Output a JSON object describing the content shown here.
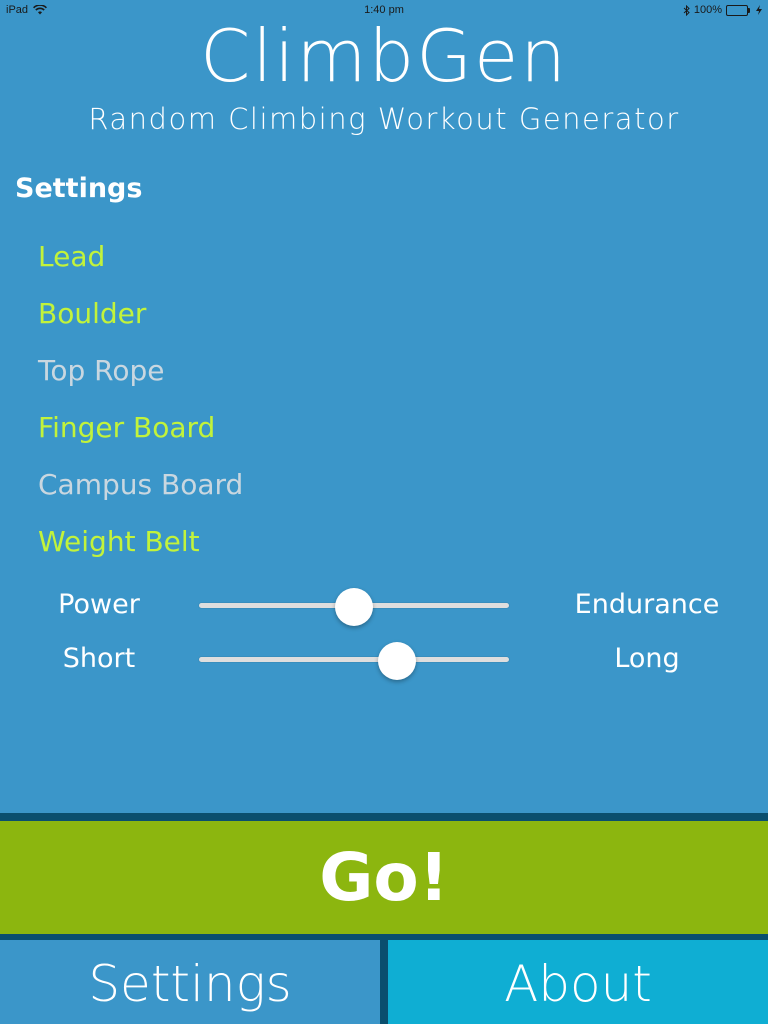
{
  "status_bar": {
    "device": "iPad",
    "time": "1:40 pm",
    "battery": "100%"
  },
  "header": {
    "title": "ClimbGen",
    "subtitle": "Random Climbing Workout Generator"
  },
  "settings": {
    "heading": "Settings",
    "options": [
      {
        "label": "Lead",
        "enabled": true
      },
      {
        "label": "Boulder",
        "enabled": true
      },
      {
        "label": "Top Rope",
        "enabled": false
      },
      {
        "label": "Finger Board",
        "enabled": true
      },
      {
        "label": "Campus Board",
        "enabled": false
      },
      {
        "label": "Weight Belt",
        "enabled": true
      }
    ]
  },
  "sliders": [
    {
      "left_label": "Power",
      "right_label": "Endurance",
      "value": 0.5
    },
    {
      "left_label": "Short",
      "right_label": "Long",
      "value": 0.64
    }
  ],
  "go_button": {
    "label": "Go!"
  },
  "tabs": [
    {
      "label": "Settings"
    },
    {
      "label": "About"
    }
  ],
  "colors": {
    "background": "#3b96c9",
    "enabled_option": "#c2f33b",
    "disabled_option": "#c9d7e0",
    "go_button": "#8cb60f",
    "about_tab": "#0faed3"
  }
}
